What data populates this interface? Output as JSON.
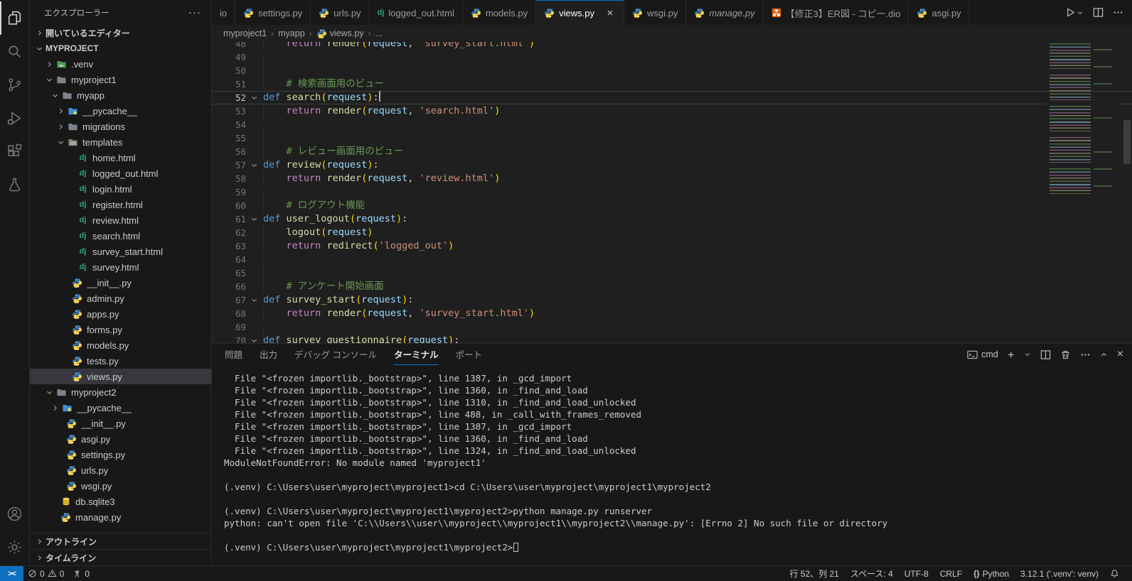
{
  "activity_bar": {
    "top": [
      {
        "name": "explorer",
        "active": true
      },
      {
        "name": "search"
      },
      {
        "name": "source-control"
      },
      {
        "name": "run-debug"
      },
      {
        "name": "extensions"
      },
      {
        "name": "testing"
      }
    ],
    "bottom": [
      {
        "name": "account"
      },
      {
        "name": "settings"
      }
    ]
  },
  "sidebar": {
    "title": "エクスプローラー",
    "more_actions": "···",
    "open_editors_label": "開いているエディター",
    "root_label": "MYPROJECT",
    "outline_label": "アウトライン",
    "timeline_label": "タイムライン",
    "tree": [
      {
        "label": ".venv",
        "depth": 1,
        "icon": "folder-venv",
        "expanded": false
      },
      {
        "label": "myproject1",
        "depth": 1,
        "icon": "folder",
        "expanded": true
      },
      {
        "label": "myapp",
        "depth": 2,
        "icon": "folder",
        "expanded": true
      },
      {
        "label": "__pycache__",
        "depth": 3,
        "icon": "folder-pycache",
        "expanded": false
      },
      {
        "label": "migrations",
        "depth": 3,
        "icon": "folder",
        "expanded": false
      },
      {
        "label": "templates",
        "depth": 3,
        "icon": "folder-templates",
        "expanded": true
      },
      {
        "label": "home.html",
        "depth": 4,
        "icon": "dj"
      },
      {
        "label": "logged_out.html",
        "depth": 4,
        "icon": "dj"
      },
      {
        "label": "login.html",
        "depth": 4,
        "icon": "dj"
      },
      {
        "label": "register.html",
        "depth": 4,
        "icon": "dj"
      },
      {
        "label": "review.html",
        "depth": 4,
        "icon": "dj"
      },
      {
        "label": "search.html",
        "depth": 4,
        "icon": "dj"
      },
      {
        "label": "survey_start.html",
        "depth": 4,
        "icon": "dj"
      },
      {
        "label": "survey.html",
        "depth": 4,
        "icon": "dj"
      },
      {
        "label": "__init__.py",
        "depth": 3,
        "icon": "py"
      },
      {
        "label": "admin.py",
        "depth": 3,
        "icon": "py"
      },
      {
        "label": "apps.py",
        "depth": 3,
        "icon": "py"
      },
      {
        "label": "forms.py",
        "depth": 3,
        "icon": "py"
      },
      {
        "label": "models.py",
        "depth": 3,
        "icon": "py"
      },
      {
        "label": "tests.py",
        "depth": 3,
        "icon": "py"
      },
      {
        "label": "views.py",
        "depth": 3,
        "icon": "py",
        "selected": true
      },
      {
        "label": "myproject2",
        "depth": 1,
        "icon": "folder",
        "expanded": true
      },
      {
        "label": "__pycache__",
        "depth": 2,
        "icon": "folder-pycache",
        "expanded": false
      },
      {
        "label": "__init__.py",
        "depth": 2,
        "icon": "py"
      },
      {
        "label": "asgi.py",
        "depth": 2,
        "icon": "py"
      },
      {
        "label": "settings.py",
        "depth": 2,
        "icon": "py"
      },
      {
        "label": "urls.py",
        "depth": 2,
        "icon": "py"
      },
      {
        "label": "wsgi.py",
        "depth": 2,
        "icon": "py"
      },
      {
        "label": "db.sqlite3",
        "depth": 1,
        "icon": "db"
      },
      {
        "label": "manage.py",
        "depth": 1,
        "icon": "py"
      }
    ]
  },
  "tabs": [
    {
      "label": "io",
      "partial": true
    },
    {
      "label": "settings.py",
      "icon": "py"
    },
    {
      "label": "urls.py",
      "icon": "py"
    },
    {
      "label": "logged_out.html",
      "icon": "dj"
    },
    {
      "label": "models.py",
      "icon": "py"
    },
    {
      "label": "views.py",
      "icon": "py",
      "active": true,
      "close": "×"
    },
    {
      "label": "wsgi.py",
      "icon": "py"
    },
    {
      "label": "manage.py",
      "icon": "py",
      "italic": true
    },
    {
      "label": "【修正3】ER図 - コピー.dio",
      "icon": "dio"
    },
    {
      "label": "asgi.py",
      "icon": "py"
    }
  ],
  "breadcrumbs": [
    {
      "label": "myproject1"
    },
    {
      "label": "myapp"
    },
    {
      "label": "views.py",
      "icon": "py"
    },
    {
      "label": "..."
    }
  ],
  "editor": {
    "lines": [
      {
        "n": 48,
        "g": 1,
        "t": [
          [
            "pl",
            "    "
          ],
          [
            "ctl",
            "return"
          ],
          [
            "pl",
            " "
          ],
          [
            "fn",
            "render"
          ],
          [
            "br",
            "("
          ],
          [
            "var",
            "request"
          ],
          [
            "pl",
            ", "
          ],
          [
            "str",
            "'survey_start.html'"
          ],
          [
            "br",
            ")"
          ]
        ]
      },
      {
        "n": 49,
        "g": 1,
        "t": []
      },
      {
        "n": 50,
        "g": 1,
        "t": []
      },
      {
        "n": 51,
        "g": 1,
        "t": [
          [
            "pl",
            "    "
          ],
          [
            "cm",
            "# 検索画面用のビュー"
          ]
        ]
      },
      {
        "n": 52,
        "f": 1,
        "cur": 1,
        "caret": 1,
        "t": [
          [
            "kw",
            "def"
          ],
          [
            "pl",
            " "
          ],
          [
            "fn",
            "search"
          ],
          [
            "br",
            "("
          ],
          [
            "var",
            "request"
          ],
          [
            "br",
            ")"
          ],
          [
            "pl",
            ":"
          ]
        ]
      },
      {
        "n": 53,
        "g": 1,
        "t": [
          [
            "pl",
            "    "
          ],
          [
            "ctl",
            "return"
          ],
          [
            "pl",
            " "
          ],
          [
            "fn",
            "render"
          ],
          [
            "br",
            "("
          ],
          [
            "var",
            "request"
          ],
          [
            "pl",
            ", "
          ],
          [
            "str",
            "'search.html'"
          ],
          [
            "br",
            ")"
          ]
        ]
      },
      {
        "n": 54,
        "g": 1,
        "t": []
      },
      {
        "n": 55,
        "g": 1,
        "t": []
      },
      {
        "n": 56,
        "g": 1,
        "t": [
          [
            "pl",
            "    "
          ],
          [
            "cm",
            "# レビュー画面用のビュー"
          ]
        ]
      },
      {
        "n": 57,
        "f": 1,
        "t": [
          [
            "kw",
            "def"
          ],
          [
            "pl",
            " "
          ],
          [
            "fn",
            "review"
          ],
          [
            "br",
            "("
          ],
          [
            "var",
            "request"
          ],
          [
            "br",
            ")"
          ],
          [
            "pl",
            ":"
          ]
        ]
      },
      {
        "n": 58,
        "g": 1,
        "t": [
          [
            "pl",
            "    "
          ],
          [
            "ctl",
            "return"
          ],
          [
            "pl",
            " "
          ],
          [
            "fn",
            "render"
          ],
          [
            "br",
            "("
          ],
          [
            "var",
            "request"
          ],
          [
            "pl",
            ", "
          ],
          [
            "str",
            "'review.html'"
          ],
          [
            "br",
            ")"
          ]
        ]
      },
      {
        "n": 59,
        "g": 1,
        "t": []
      },
      {
        "n": 60,
        "g": 1,
        "t": [
          [
            "pl",
            "    "
          ],
          [
            "cm",
            "# ログアウト機能"
          ]
        ]
      },
      {
        "n": 61,
        "f": 1,
        "t": [
          [
            "kw",
            "def"
          ],
          [
            "pl",
            " "
          ],
          [
            "fn",
            "user_logout"
          ],
          [
            "br",
            "("
          ],
          [
            "var",
            "request"
          ],
          [
            "br",
            ")"
          ],
          [
            "pl",
            ":"
          ]
        ]
      },
      {
        "n": 62,
        "g": 1,
        "t": [
          [
            "pl",
            "    "
          ],
          [
            "fn",
            "logout"
          ],
          [
            "br",
            "("
          ],
          [
            "var",
            "request"
          ],
          [
            "br",
            ")"
          ]
        ]
      },
      {
        "n": 63,
        "g": 1,
        "t": [
          [
            "pl",
            "    "
          ],
          [
            "ctl",
            "return"
          ],
          [
            "pl",
            " "
          ],
          [
            "fn",
            "redirect"
          ],
          [
            "br",
            "("
          ],
          [
            "str",
            "'logged_out'"
          ],
          [
            "br",
            ")"
          ]
        ]
      },
      {
        "n": 64,
        "g": 1,
        "t": []
      },
      {
        "n": 65,
        "g": 1,
        "t": []
      },
      {
        "n": 66,
        "g": 1,
        "t": [
          [
            "pl",
            "    "
          ],
          [
            "cm",
            "# アンケート開始画面"
          ]
        ]
      },
      {
        "n": 67,
        "f": 1,
        "t": [
          [
            "kw",
            "def"
          ],
          [
            "pl",
            " "
          ],
          [
            "fn",
            "survey_start"
          ],
          [
            "br",
            "("
          ],
          [
            "var",
            "request"
          ],
          [
            "br",
            ")"
          ],
          [
            "pl",
            ":"
          ]
        ]
      },
      {
        "n": 68,
        "g": 1,
        "t": [
          [
            "pl",
            "    "
          ],
          [
            "ctl",
            "return"
          ],
          [
            "pl",
            " "
          ],
          [
            "fn",
            "render"
          ],
          [
            "br",
            "("
          ],
          [
            "var",
            "request"
          ],
          [
            "pl",
            ", "
          ],
          [
            "str",
            "'survey_start.html'"
          ],
          [
            "br",
            ")"
          ]
        ]
      },
      {
        "n": 69,
        "g": 1,
        "t": []
      },
      {
        "n": 70,
        "f": 1,
        "t": [
          [
            "kw",
            "def"
          ],
          [
            "pl",
            " "
          ],
          [
            "fn",
            "survey_questionnaire"
          ],
          [
            "br",
            "("
          ],
          [
            "var",
            "request"
          ],
          [
            "br",
            ")"
          ],
          [
            "pl",
            ":"
          ]
        ]
      }
    ]
  },
  "panel": {
    "tabs": [
      {
        "label": "問題"
      },
      {
        "label": "出力"
      },
      {
        "label": "デバッグ コンソール"
      },
      {
        "label": "ターミナル",
        "active": true
      },
      {
        "label": "ポート"
      }
    ],
    "shell_label": "cmd"
  },
  "terminal": {
    "lines": [
      "  File \"<frozen importlib._bootstrap>\", line 1387, in _gcd_import",
      "  File \"<frozen importlib._bootstrap>\", line 1360, in _find_and_load",
      "  File \"<frozen importlib._bootstrap>\", line 1310, in _find_and_load_unlocked",
      "  File \"<frozen importlib._bootstrap>\", line 488, in _call_with_frames_removed",
      "  File \"<frozen importlib._bootstrap>\", line 1387, in _gcd_import",
      "  File \"<frozen importlib._bootstrap>\", line 1360, in _find_and_load",
      "  File \"<frozen importlib._bootstrap>\", line 1324, in _find_and_load_unlocked",
      "ModuleNotFoundError: No module named 'myproject1'",
      "",
      "(.venv) C:\\Users\\user\\myproject\\myproject1>cd C:\\Users\\user\\myproject\\myproject1\\myproject2",
      "",
      "(.venv) C:\\Users\\user\\myproject\\myproject1\\myproject2>python manage.py runserver",
      "python: can't open file 'C:\\\\Users\\\\user\\\\myproject\\\\myproject1\\\\myproject2\\\\manage.py': [Errno 2] No such file or directory",
      "",
      "(.venv) C:\\Users\\user\\myproject\\myproject1\\myproject2>"
    ],
    "cursor_line_index": 14
  },
  "status_bar": {
    "remote": "><",
    "errors": "0",
    "warnings": "0",
    "ports": "0",
    "right": [
      {
        "name": "cursor-position",
        "text": "行 52、列 21"
      },
      {
        "name": "indentation",
        "text": "スペース: 4"
      },
      {
        "name": "encoding",
        "text": "UTF-8"
      },
      {
        "name": "eol",
        "text": "CRLF"
      },
      {
        "name": "language-mode",
        "text": "Python",
        "brace": "{}"
      },
      {
        "name": "python-interpreter",
        "text": "3.12.1 ('.venv': venv)"
      }
    ]
  }
}
